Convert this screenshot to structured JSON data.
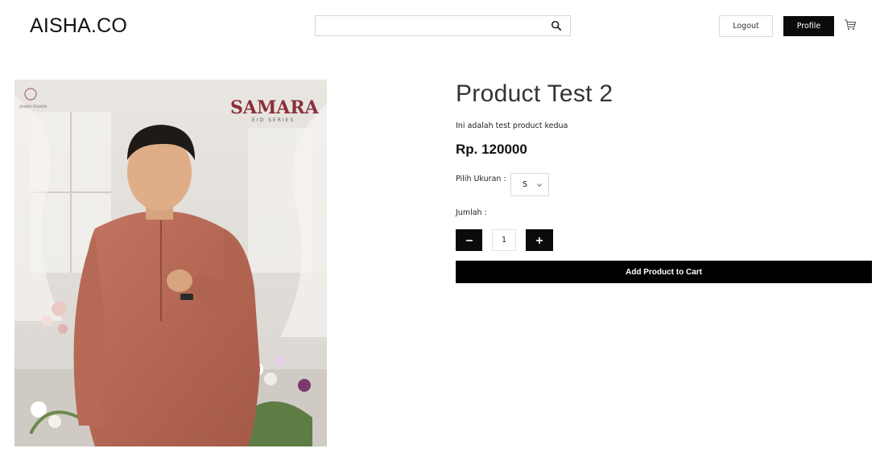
{
  "header": {
    "brand": "AISHA.CO",
    "search": {
      "value": "",
      "placeholder": ""
    },
    "logout_label": "Logout",
    "profile_label": "Profile"
  },
  "product": {
    "image_text": {
      "logo_text": "QIANKA FASHION",
      "collection": "SAMARA",
      "series": "EID SERIES"
    },
    "name": "Product Test 2",
    "description": "Ini adalah test product kedua",
    "price": "Rp. 120000",
    "size_label": "Pilih Ukuran :",
    "size_selected": "S",
    "quantity_label": "Jumlah :",
    "quantity": "1",
    "add_to_cart_label": "Add Product to Cart"
  },
  "colors": {
    "primary": "#0b0b0b",
    "shirt": "#b96a55"
  },
  "icons": {
    "search": "search-icon",
    "cart": "cart-icon",
    "minus": "minus-icon",
    "plus": "plus-icon"
  }
}
